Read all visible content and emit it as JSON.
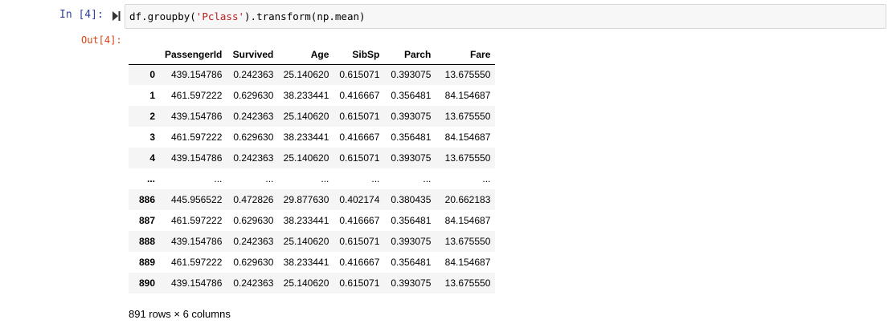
{
  "input_prompt": "In [4]:",
  "output_prompt": "Out[4]:",
  "code": {
    "before": "df.groupby(",
    "string": "'Pclass'",
    "after": ").transform(np.mean)"
  },
  "table": {
    "index_header": "",
    "columns": [
      "PassengerId",
      "Survived",
      "Age",
      "SibSp",
      "Parch",
      "Fare"
    ],
    "rows": [
      {
        "index": "0",
        "values": [
          "439.154786",
          "0.242363",
          "25.140620",
          "0.615071",
          "0.393075",
          "13.675550"
        ]
      },
      {
        "index": "1",
        "values": [
          "461.597222",
          "0.629630",
          "38.233441",
          "0.416667",
          "0.356481",
          "84.154687"
        ]
      },
      {
        "index": "2",
        "values": [
          "439.154786",
          "0.242363",
          "25.140620",
          "0.615071",
          "0.393075",
          "13.675550"
        ]
      },
      {
        "index": "3",
        "values": [
          "461.597222",
          "0.629630",
          "38.233441",
          "0.416667",
          "0.356481",
          "84.154687"
        ]
      },
      {
        "index": "4",
        "values": [
          "439.154786",
          "0.242363",
          "25.140620",
          "0.615071",
          "0.393075",
          "13.675550"
        ]
      },
      {
        "index": "...",
        "values": [
          "...",
          "...",
          "...",
          "...",
          "...",
          "..."
        ]
      },
      {
        "index": "886",
        "values": [
          "445.956522",
          "0.472826",
          "29.877630",
          "0.402174",
          "0.380435",
          "20.662183"
        ]
      },
      {
        "index": "887",
        "values": [
          "461.597222",
          "0.629630",
          "38.233441",
          "0.416667",
          "0.356481",
          "84.154687"
        ]
      },
      {
        "index": "888",
        "values": [
          "439.154786",
          "0.242363",
          "25.140620",
          "0.615071",
          "0.393075",
          "13.675550"
        ]
      },
      {
        "index": "889",
        "values": [
          "461.597222",
          "0.629630",
          "38.233441",
          "0.416667",
          "0.356481",
          "84.154687"
        ]
      },
      {
        "index": "890",
        "values": [
          "439.154786",
          "0.242363",
          "25.140620",
          "0.615071",
          "0.393075",
          "13.675550"
        ]
      }
    ]
  },
  "shape_note": "891 rows × 6 columns",
  "icons": {
    "run": "run-cell-icon"
  },
  "colors": {
    "input_prompt": "#303f9f",
    "output_prompt": "#d84315",
    "string_literal": "#ba2121",
    "cell_background": "#f7f7f7",
    "cell_border": "#d7d7d7",
    "stripe": "#f5f5f5"
  }
}
